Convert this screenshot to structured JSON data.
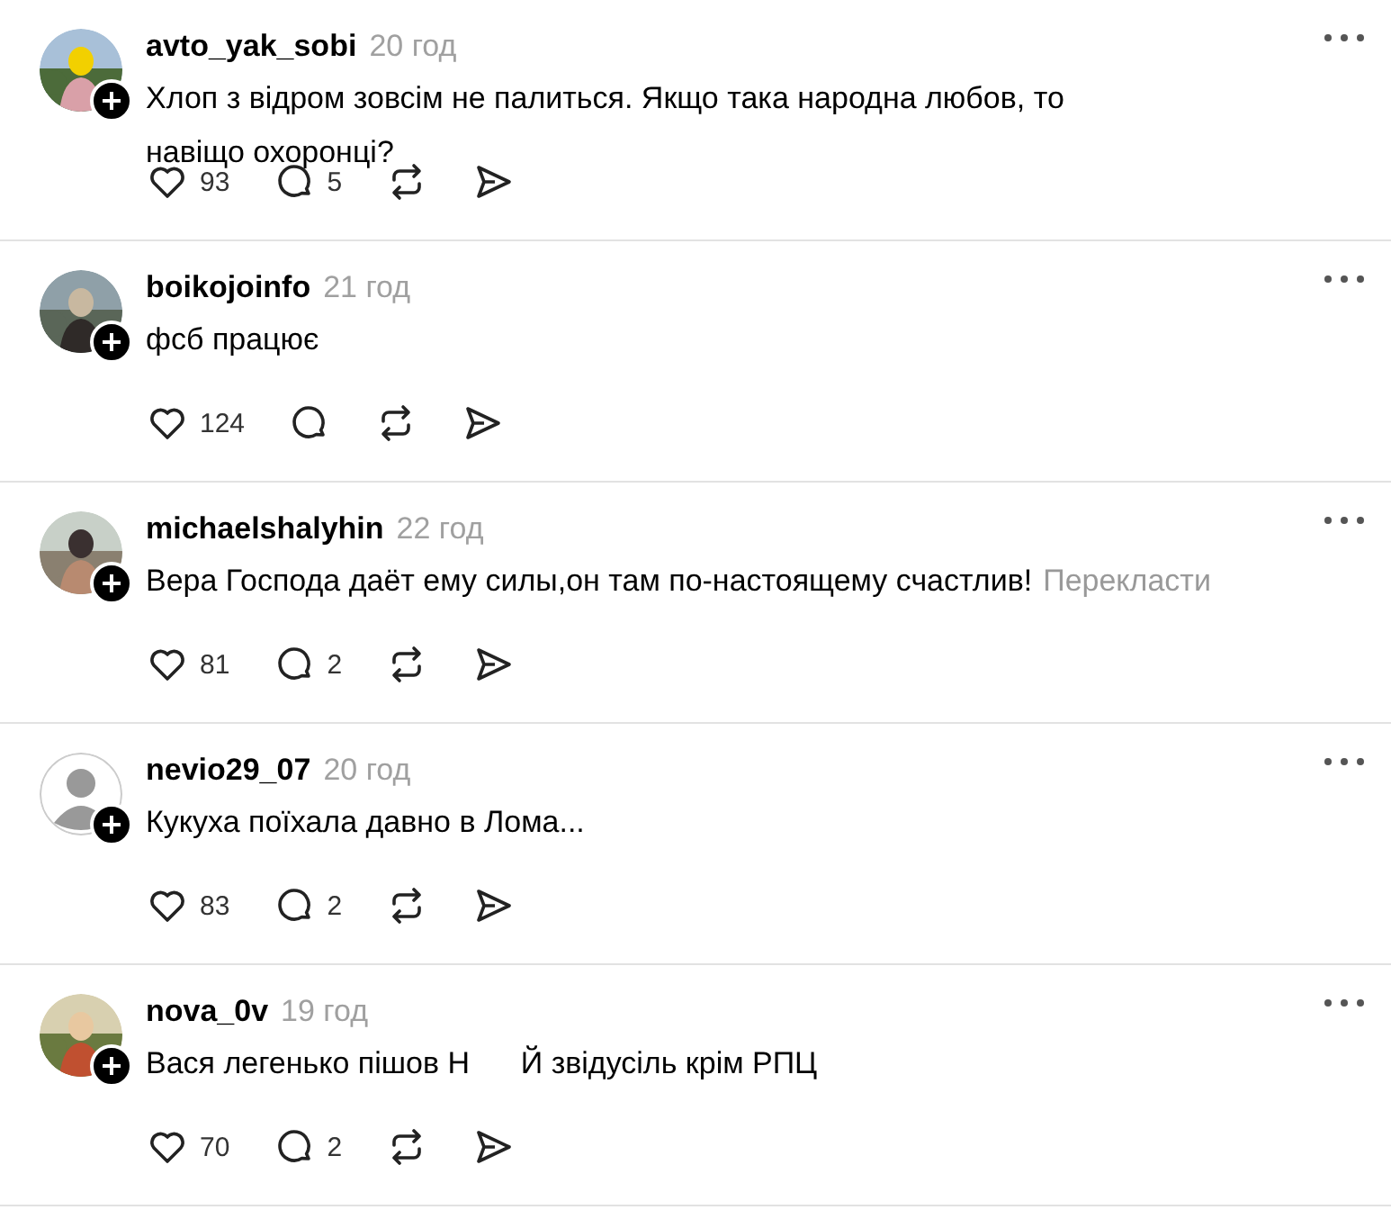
{
  "comments": [
    {
      "username": "avto_yak_sobi",
      "time": "20 год",
      "text": "Хлоп з відром зовсім не палиться. Якщо така народна любов, то навіщо охоронці?",
      "likes": "93",
      "replies": "5"
    },
    {
      "username": "boikojoinfo",
      "time": "21 год",
      "text": "фсб працює",
      "likes": "124"
    },
    {
      "username": "michaelshalyhin",
      "time": "22 год",
      "text": "Вера Господа даёт ему силы,он там по-настоящему счастлив!",
      "translate": "Перекласти",
      "likes": "81",
      "replies": "2"
    },
    {
      "avatar": {
        "kind": "default"
      },
      "username": "nevio29_07",
      "time": "20 год",
      "text": "Кукуха поїхала давно в Лома...",
      "likes": "83",
      "replies": "2"
    },
    {
      "username": "nova_0v",
      "time": "19 год",
      "text": "Вася легенько пішов Н      Й звідусіль крім РПЦ",
      "likes": "70",
      "replies": "2"
    }
  ]
}
